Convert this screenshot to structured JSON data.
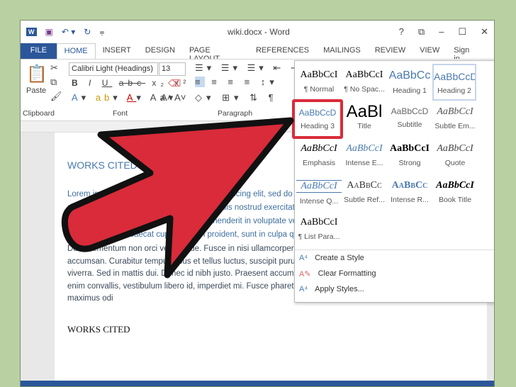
{
  "window": {
    "title": "wiki.docx - Word",
    "controls": [
      "?",
      "⧉",
      "–",
      "☐",
      "✕"
    ]
  },
  "tabs": [
    "FILE",
    "HOME",
    "INSERT",
    "DESIGN",
    "PAGE LAYOUT",
    "REFERENCES",
    "MAILINGS",
    "REVIEW",
    "VIEW"
  ],
  "signin": "Sign in",
  "ribbon": {
    "font_name": "Calibri Light (Headings)",
    "font_size": "13",
    "paste": "Paste",
    "groups": [
      "Clipboard",
      "Font",
      "Paragraph"
    ]
  },
  "styles": [
    {
      "sample": "AaBbCcI",
      "name": "¶ Normal"
    },
    {
      "sample": "AaBbCcI",
      "name": "¶ No Spac..."
    },
    {
      "sample": "AaBbCc",
      "name": "Heading 1"
    },
    {
      "sample": "AaBbCcD",
      "name": "Heading 2"
    },
    {
      "sample": "AaBbCcD",
      "name": "Heading 3"
    },
    {
      "sample": "AaBl",
      "name": "Title"
    },
    {
      "sample": "AaBbCcD",
      "name": "Subtitle"
    },
    {
      "sample": "AaBbCcI",
      "name": "Subtle Em..."
    },
    {
      "sample": "AaBbCcI",
      "name": "Emphasis"
    },
    {
      "sample": "AaBbCcI",
      "name": "Intense E..."
    },
    {
      "sample": "AaBbCcI",
      "name": "Strong"
    },
    {
      "sample": "AaBbCcI",
      "name": "Quote"
    },
    {
      "sample": "AaBbCcI",
      "name": "Intense Q..."
    },
    {
      "sample": "AaBbCc",
      "name": "Subtle Ref..."
    },
    {
      "sample": "AaBbCc",
      "name": "Intense R..."
    },
    {
      "sample": "AaBbCcI",
      "name": "Book Title"
    },
    {
      "sample": "AaBbCcI",
      "name": "¶ List Para..."
    }
  ],
  "menu": [
    "Create a Style",
    "Clear Formatting",
    "Apply Styles..."
  ],
  "doc": {
    "heading": "WORKS CITED",
    "para1": "Lorem ipsum dolor sit amet, consectetur adipiscing elit, sed do eiusmod tempor incididunt ut labore et dolore magna aliqua. Ut enim ad minim veniam, quis nostrud exercitation ullamco laboris nisi ut aliquip ex ea commodo consequat. Duis aute irure dolor in reprehenderit in voluptate velit esse cillum dolore eu fugiat nulla pariatur. Excepteur sint occaecat cupidatat non proident, sunt in culpa qui officia deserunt mollit anim id est laborum.\".",
    "para2": " Duis elementum non orci vel congue. Fusce in nisi ullamcorper, pulvinar lectus at, fermentum facilisis risus vitae accumsan. Curabitur tempus risus et tellus luctus, suscipit purus molestie. Aenean vel lorem non ligula pretium viverra. Sed in mattis dui. Donec id nibh justo. Praesent accumsan rhoncus magna sit amet fermentum. Nunc a enim convallis, vestibulum libero id, imperdiet mi. Fusce pharetra commodo metus id pellentesque. Nam eget maximus odi",
    "heading2": "WORKS CITED"
  },
  "colors": {
    "accent": "#2b579a",
    "arrow": "#d92b3a",
    "highlight": "#d92b3a"
  }
}
